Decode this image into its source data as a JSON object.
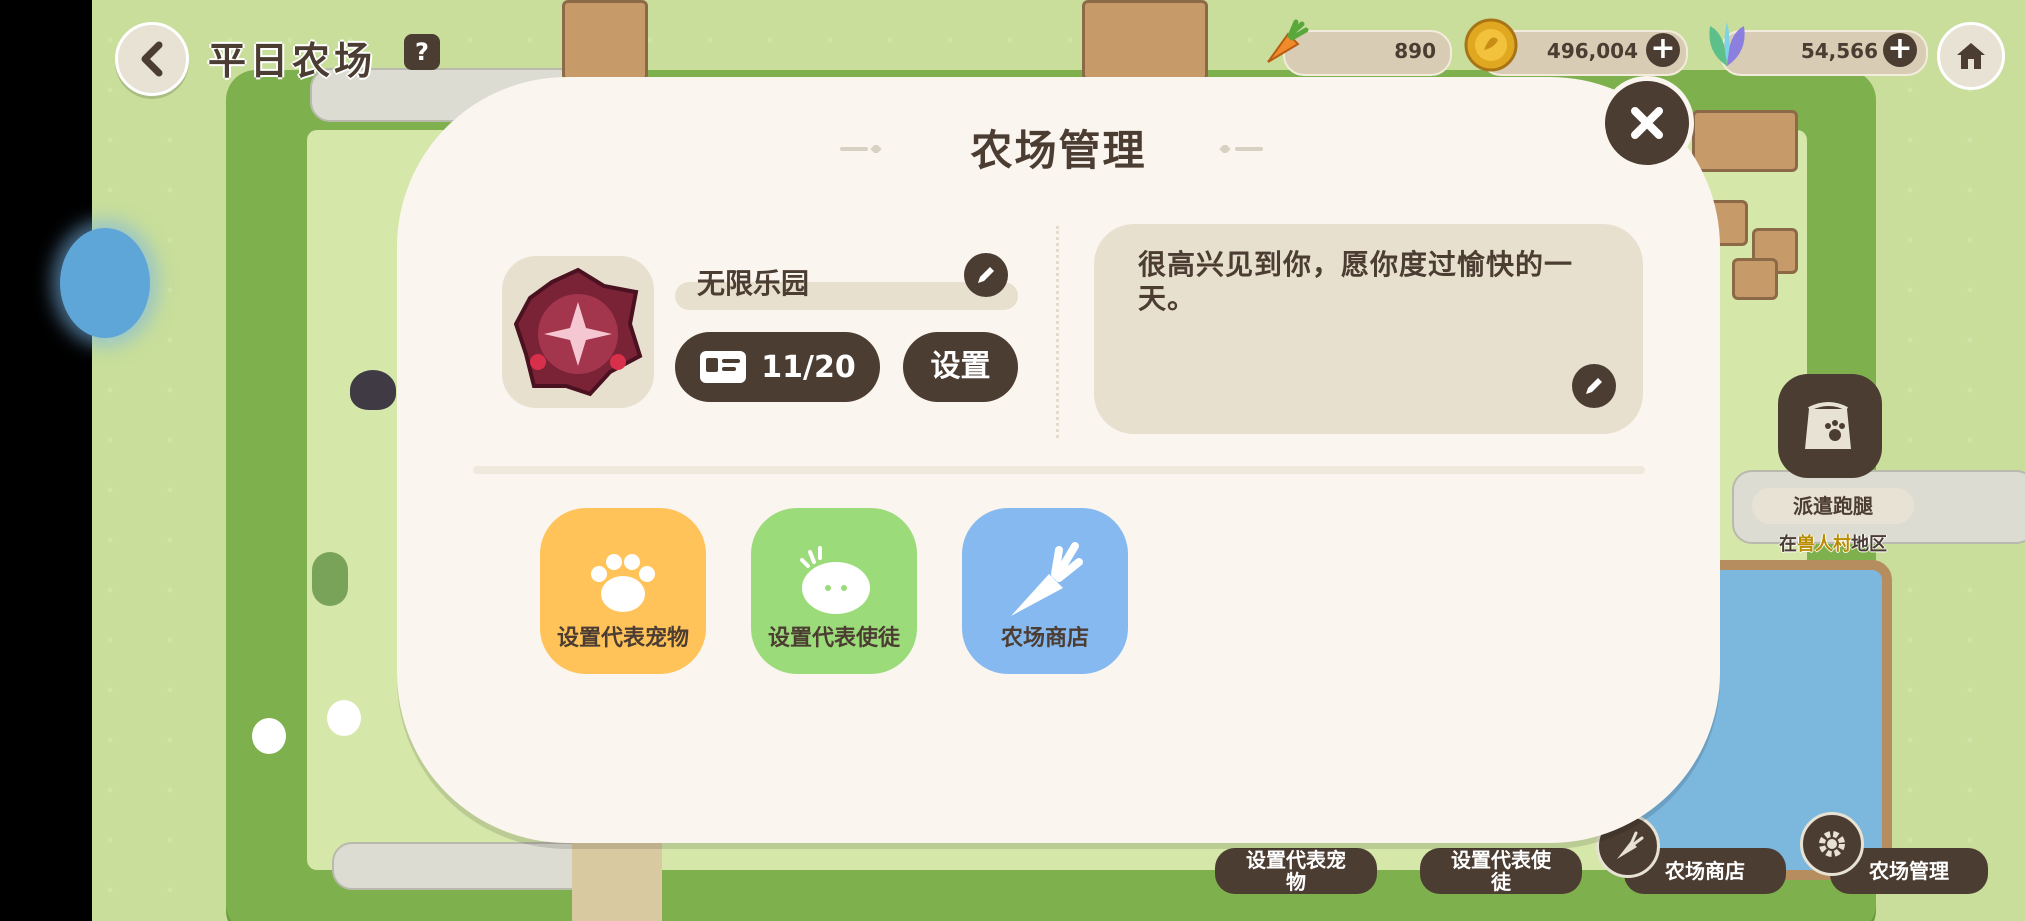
{
  "header": {
    "back_icon": "chevron-left-icon",
    "title": "平日农场",
    "help_icon": "question-icon"
  },
  "resources": [
    {
      "name": "carrot",
      "icon": "carrot-icon",
      "value": "890"
    },
    {
      "name": "gold-coin",
      "icon": "coin-icon",
      "value": "496,004"
    },
    {
      "name": "crystal-leaf",
      "icon": "leaf-gem-icon",
      "value": "54,566"
    }
  ],
  "home_icon": "home-icon",
  "side": {
    "dispatch_label": "派遣跑腿",
    "dispatch_location_prefix": "在",
    "dispatch_location_highlight": "兽人村",
    "dispatch_location_suffix": "地区"
  },
  "bottom_bar": [
    {
      "label": "设置代表宠物",
      "icon": "paw-icon"
    },
    {
      "label": "设置代表使徒",
      "icon": "apostle-icon"
    },
    {
      "label": "农场商店",
      "icon": "carrot-icon"
    },
    {
      "label": "农场管理",
      "icon": "gear-icon"
    }
  ],
  "modal": {
    "title": "农场管理",
    "close_icon": "close-icon",
    "farm_name": "无限乐园",
    "visit_count": "11/20",
    "settings_label": "设置",
    "greeting": "很高兴见到你，愿你度过愉快的一天。",
    "actions": [
      {
        "label": "设置代表宠物",
        "icon": "paw-icon",
        "color": "#ffc35a"
      },
      {
        "label": "设置代表使徒",
        "icon": "apostle-icon",
        "color": "#9bdb7a"
      },
      {
        "label": "农场商店",
        "icon": "carrot-icon",
        "color": "#86b9ef"
      }
    ]
  },
  "colors": {
    "modal_bg": "#faf5ee",
    "dark_brown": "#4c3d33",
    "field_bg": "#e8e0cf",
    "grass": "#c8de9a"
  }
}
